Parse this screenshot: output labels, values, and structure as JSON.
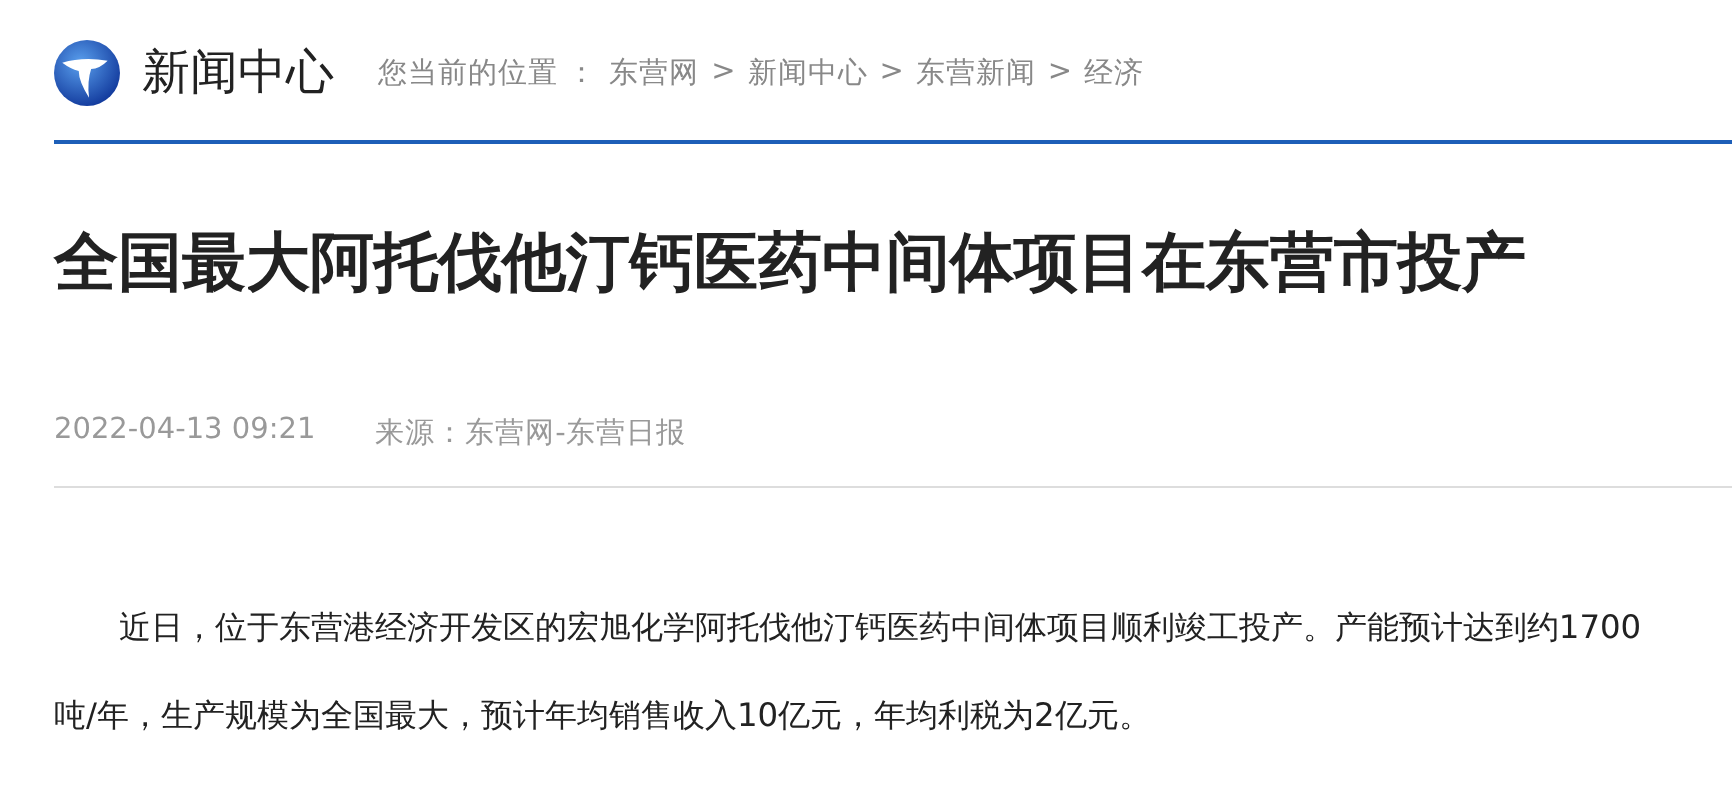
{
  "header": {
    "site_name": "新闻中心",
    "breadcrumb_label": "您当前的位置 ：",
    "breadcrumb": [
      {
        "label": "东营网"
      },
      {
        "label": "新闻中心"
      },
      {
        "label": "东营新闻"
      },
      {
        "label": "经济"
      }
    ],
    "separator": ">"
  },
  "article": {
    "title": "全国最大阿托伐他汀钙医药中间体项目在东营市投产",
    "date": "2022-04-13 09:21",
    "source": "来源：东营网-东营日报",
    "paragraphs": [
      "近日，位于东营港经济开发区的宏旭化学阿托伐他汀钙医药中间体项目顺利竣工投产。产能预计达到约1700吨/年，生产规模为全国最大，预计年均销售收入10亿元，年均利税为2亿元。"
    ]
  }
}
